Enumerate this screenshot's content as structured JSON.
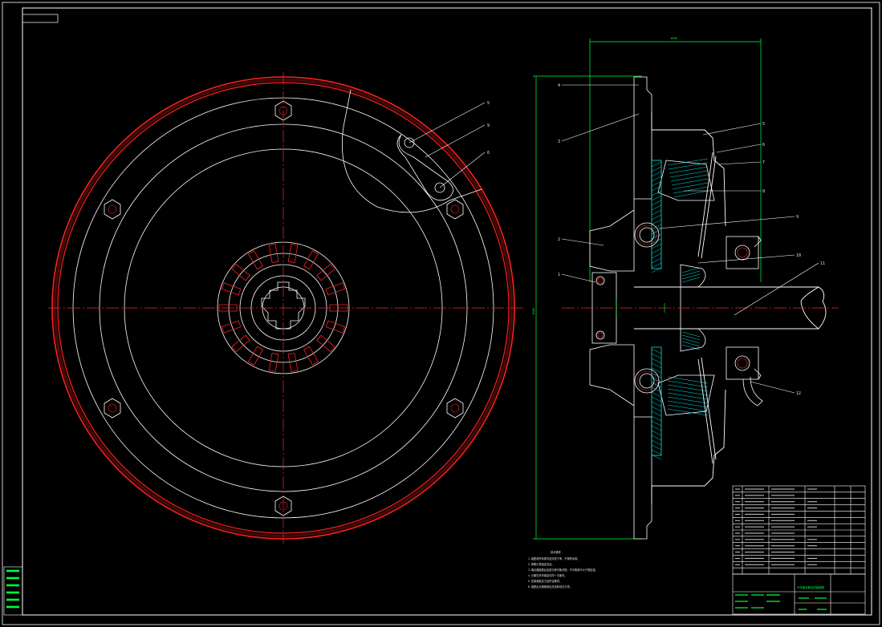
{
  "colors": {
    "background": "#000000",
    "outline": "#ffffff",
    "centerline": "#ff2020",
    "hatch": "#00e5e5",
    "dimension": "#00ff3c",
    "title_text": "#00ff3c"
  },
  "front_view": {
    "callouts": [
      "5",
      "9",
      "6"
    ]
  },
  "section_view": {
    "left_callouts": [
      "4",
      "3",
      "2",
      "1"
    ],
    "right_callouts": [
      "5",
      "6",
      "7",
      "8",
      "9",
      "10",
      "11",
      "12"
    ],
    "top_dimension": "Φ350",
    "side_dimension": "Φ380"
  },
  "notes": {
    "heading": "技术要求",
    "lines": [
      "1.装配前所有零件应清洗干净，不得有毛刺。",
      "2.摩擦片表面应清洁。",
      "3.离合器装配后应进行静平衡试验，不平衡量不大于规定值。",
      "4.分离杠杆内端应在同一平面内。",
      "5.压紧弹簧压力应符合要求。",
      "6.装配后分离轴承应灵活转动无卡滞。"
    ]
  },
  "title_block": {
    "drawing_title": "汽车离合器总成装配图"
  }
}
